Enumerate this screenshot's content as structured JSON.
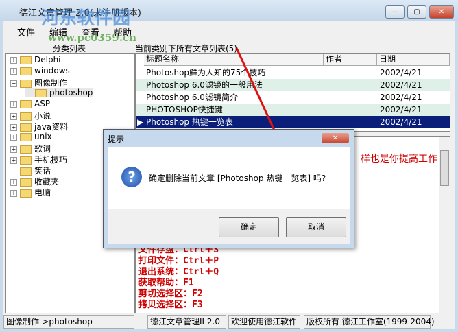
{
  "window": {
    "title": "德江文章管理 2.0(未注册版本)",
    "minimize": "—",
    "maximize": "▢",
    "close": "✕"
  },
  "menu": [
    "文件",
    "编辑",
    "查看",
    "帮助"
  ],
  "tree": {
    "header": "分类列表",
    "items": [
      {
        "label": "Delphi",
        "expander": "+",
        "level": 0
      },
      {
        "label": "windows",
        "expander": "+",
        "level": 0
      },
      {
        "label": "图像制作",
        "expander": "−",
        "level": 0
      },
      {
        "label": "photoshop",
        "expander": "",
        "level": 1
      },
      {
        "label": "ASP",
        "expander": "+",
        "level": 0
      },
      {
        "label": "小说",
        "expander": "+",
        "level": 0
      },
      {
        "label": "java资料",
        "expander": "+",
        "level": 0
      },
      {
        "label": "unix",
        "expander": "+",
        "level": 0
      },
      {
        "label": "歌词",
        "expander": "+",
        "level": 0
      },
      {
        "label": "手机技巧",
        "expander": "+",
        "level": 0
      },
      {
        "label": "笑话",
        "expander": "",
        "level": 0
      },
      {
        "label": "收藏夹",
        "expander": "+",
        "level": 0
      },
      {
        "label": "电脑",
        "expander": "+",
        "level": 0
      }
    ]
  },
  "list": {
    "header": "当前类别下所有文章列表(5)",
    "columns": [
      "标题名称",
      "作者",
      "日期"
    ],
    "rows": [
      {
        "title": "Photoshop鲜为人知的75个技巧",
        "author": "",
        "date": "2002/4/21"
      },
      {
        "title": "Photoshop 6.0滤镜的一般用法",
        "author": "",
        "date": "2002/4/21"
      },
      {
        "title": "Photoshop 6.0滤镜简介",
        "author": "",
        "date": "2002/4/21"
      },
      {
        "title": "PHOTOSHOP快捷键",
        "author": "",
        "date": "2002/4/21"
      },
      {
        "title": "Photoshop 热键一览表",
        "author": "",
        "date": "2002/4/21",
        "selected": true
      }
    ]
  },
  "content": {
    "first_line": "样也是你提高工作",
    "lines": [
      "文件存盘：Ctrl＋S",
      "打印文件：Ctrl＋P",
      "退出系统：Ctrl＋Q",
      "获取帮助：F1",
      "剪切选择区：F2",
      "拷贝选择区：F3"
    ]
  },
  "status": [
    "图像制作->photoshop",
    "德江文章管理II 2.0",
    "欢迎使用德江软件",
    "版权所有 德江工作室(1999-2004)"
  ],
  "dialog": {
    "title": "提示",
    "message": "确定删除当前文章 [Photoshop 热键一览表] 吗?",
    "ok": "确定",
    "cancel": "取消",
    "close": "✕",
    "icon": "?"
  },
  "watermark": {
    "name": "河东软件园",
    "url": "www.pc0359.cn"
  }
}
